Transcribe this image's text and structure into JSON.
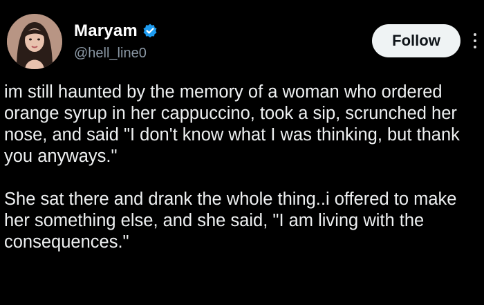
{
  "author": {
    "display_name": "Maryam",
    "handle": "@hell_line0",
    "verified": true,
    "avatar_icon": "avatar-illustration"
  },
  "actions": {
    "follow_label": "Follow",
    "more_icon": "more-options-icon"
  },
  "post": {
    "paragraphs": [
      "im still haunted by the memory of a woman who ordered orange syrup in her cappuccino, took a sip, scrunched her nose, and said \"I don't know what I was thinking, but thank you anyways.\"",
      "She sat there and drank the whole thing..i offered to make her something else, and she said, \"I am living with the consequences.\""
    ]
  },
  "colors": {
    "background": "#000000",
    "text": "#e7e9ea",
    "muted": "#8b98a5",
    "verified": "#1d9bf0",
    "follow_bg": "#eff3f4"
  }
}
